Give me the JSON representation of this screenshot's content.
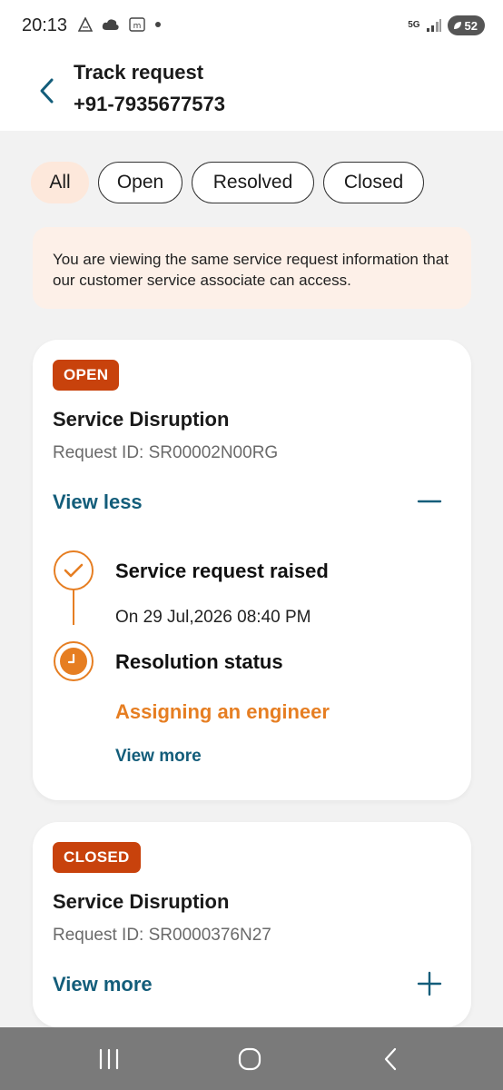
{
  "status_bar": {
    "time": "20:13",
    "network": "5G",
    "battery": "52",
    "icons": [
      "signal-tri-icon",
      "cloud-icon",
      "m-icon",
      "dot-icon",
      "5g-icon",
      "signal-icon",
      "battery-icon"
    ]
  },
  "header": {
    "title": "Track request",
    "subtitle": "+91-7935677573",
    "back_icon": "chevron-left-icon"
  },
  "filters": [
    {
      "label": "All",
      "active": true
    },
    {
      "label": "Open",
      "active": false
    },
    {
      "label": "Resolved",
      "active": false
    },
    {
      "label": "Closed",
      "active": false
    }
  ],
  "info_banner": {
    "text": "You are viewing the same service request information that our customer service associate can access."
  },
  "requests": [
    {
      "status": "OPEN",
      "title": "Service Disruption",
      "request_id": "Request ID: SR00002N00RG",
      "toggle_label": "View less",
      "expanded": true,
      "timeline": [
        {
          "title": "Service request raised",
          "detail": "On 29 Jul,2026 08:40 PM",
          "icon": "check-icon"
        },
        {
          "title": "Resolution status",
          "detail": "Assigning an engineer",
          "icon": "clock-icon",
          "link": "View more"
        }
      ]
    },
    {
      "status": "CLOSED",
      "title": "Service Disruption",
      "request_id": "Request ID: SR0000376N27",
      "toggle_label": "View more",
      "expanded": false
    }
  ],
  "colors": {
    "accent": "#e67e22",
    "badge": "#c8420c",
    "link": "#135d7a",
    "chip_active": "#fde8db",
    "banner": "#fdf0e8"
  }
}
